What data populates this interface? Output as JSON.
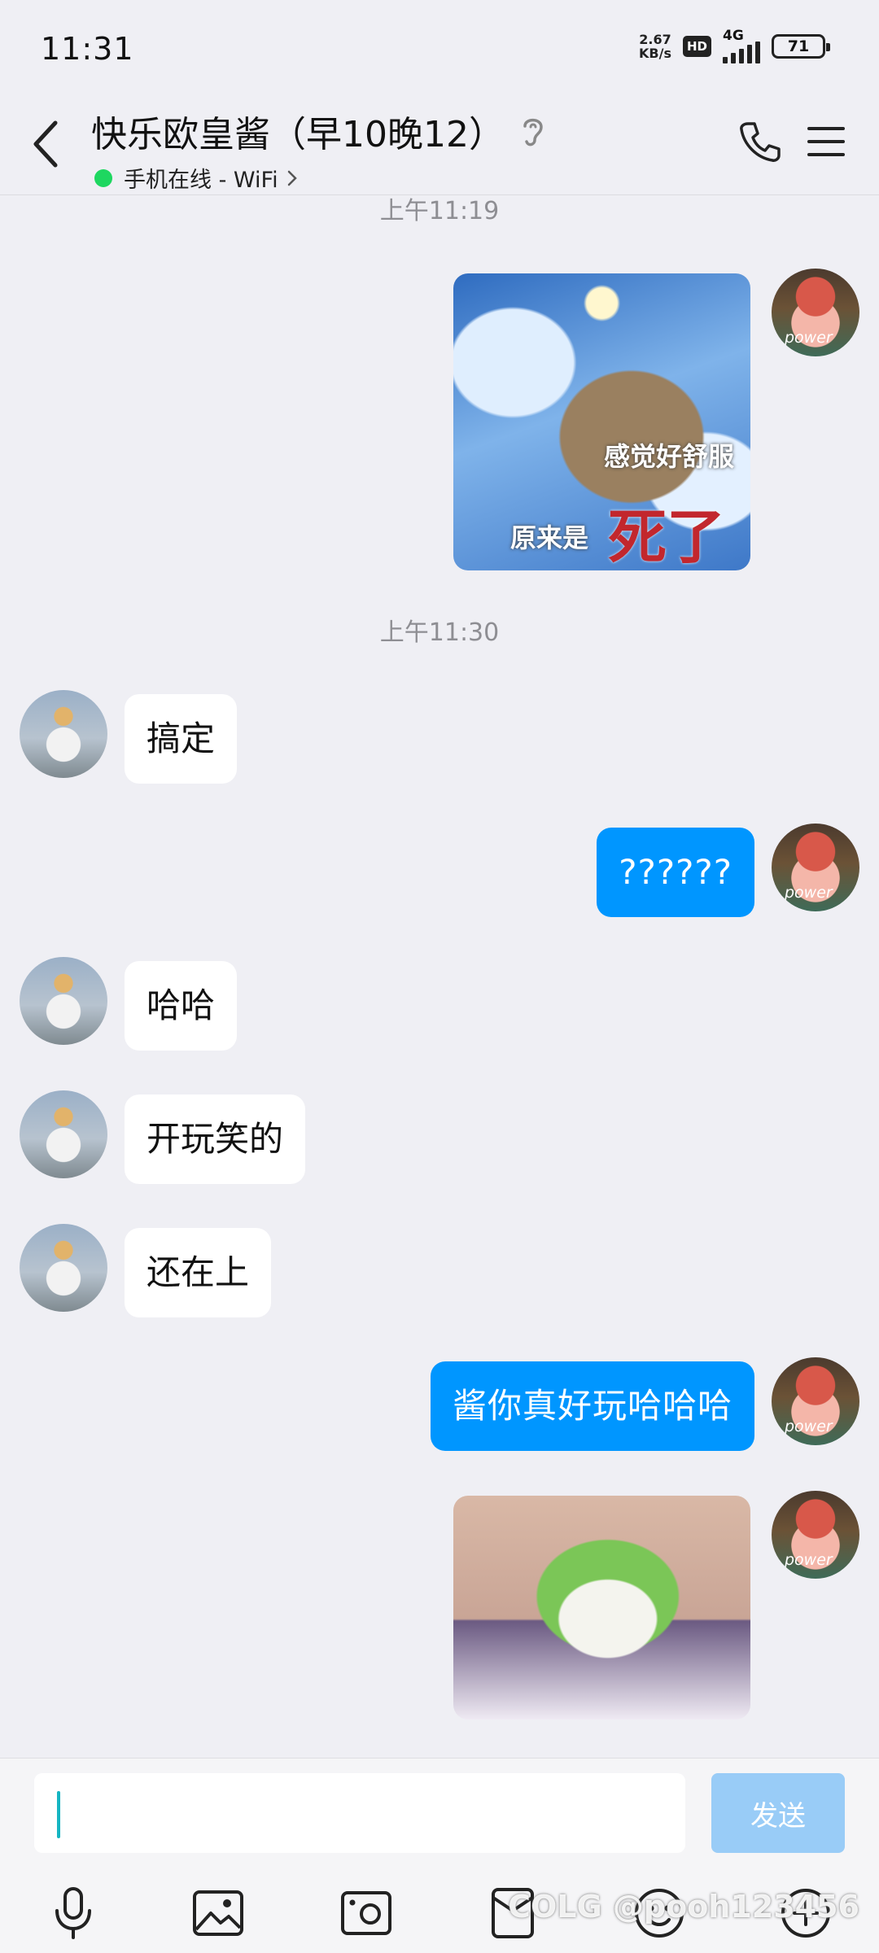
{
  "status_bar": {
    "time": "11:31",
    "net_speed_value": "2.67",
    "net_speed_unit": "KB/s",
    "hd": "HD",
    "network": "4G",
    "battery": "71"
  },
  "header": {
    "title": "快乐欧皇酱（早10晚12）",
    "status_text": "手机在线 - WiFi",
    "online_color": "#1ed760"
  },
  "timestamps": [
    "上午11:19",
    "上午11:30"
  ],
  "messages": {
    "cat_image_caption_top": "感觉好舒服",
    "cat_image_caption_bottom": "原来是",
    "cat_image_caption_big": "死了",
    "m1": "搞定",
    "m2": "??????",
    "m3": "哈哈",
    "m4": "开玩笑的",
    "m5": "还在上",
    "m6": "酱你真好玩哈哈哈"
  },
  "avatar_self_text": "power",
  "input": {
    "placeholder": "",
    "value": "",
    "send_label": "发送"
  },
  "toolbar": {
    "icons": [
      "microphone-icon",
      "image-icon",
      "camera-icon",
      "red-packet-icon",
      "emoji-icon",
      "plus-icon"
    ]
  },
  "watermark": "COLG @pooh123456",
  "colors": {
    "accent": "#0096ff",
    "send_disabled": "#99ccf7",
    "background": "#efeff4"
  }
}
